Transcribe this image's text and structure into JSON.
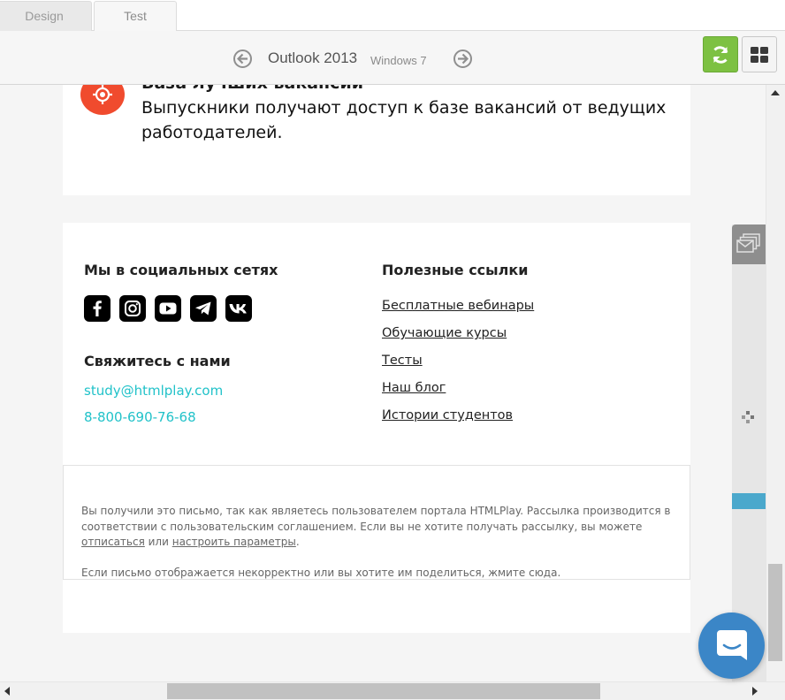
{
  "tabs": [
    {
      "label": "Design",
      "active": false
    },
    {
      "label": "Test",
      "active": true
    }
  ],
  "toolbar": {
    "client_name": "Outlook 2013",
    "client_os": "Windows 7",
    "prev_icon": "arrow-left-circle-icon",
    "next_icon": "arrow-right-circle-icon",
    "refresh_icon": "refresh-icon",
    "grid_icon": "grid-icon",
    "refresh_color": "#7dc142"
  },
  "email": {
    "feature": {
      "icon": "target-icon",
      "icon_color": "#f04b2e",
      "title": "База лучших вакансий",
      "description": "Выпускники получают доступ к базе вакансий от ведущих работодателей."
    },
    "social": {
      "title": "Мы в социальных сетях",
      "icons": [
        "facebook-icon",
        "instagram-icon",
        "youtube-icon",
        "telegram-icon",
        "vk-icon"
      ]
    },
    "contact": {
      "title": "Свяжитесь с нами",
      "email": "study@htmlplay.com",
      "phone": "8-800-690-76-68",
      "accent_color": "#21c2c9"
    },
    "links": {
      "title": "Полезные ссылки",
      "items": [
        "Бесплатные вебинары",
        "Обучающие курсы",
        "Тесты",
        "Наш блог",
        "Истории студентов"
      ]
    },
    "legal": {
      "text_part1": "Вы получили это письмо, так как являетесь пользователем портала HTMLPlay. Рассылка производится в соответствии с пользовательским соглашением. Если вы не хотите получать рассылку, вы можете ",
      "unsubscribe_link": "отписаться",
      "text_or": " или ",
      "settings_link": "настроить параметры",
      "text_end": ".",
      "text2_part1": "Если письмо отображается некорректно или вы хотите им поделиться, ",
      "view_link": "жмите сюда",
      "text2_end": "."
    }
  },
  "side_panel": {
    "tab_icon": "envelope-stack-icon",
    "drag_icon": "drag-dots-icon"
  },
  "chat": {
    "icon": "chat-smile-icon",
    "color": "#3b86c7"
  }
}
